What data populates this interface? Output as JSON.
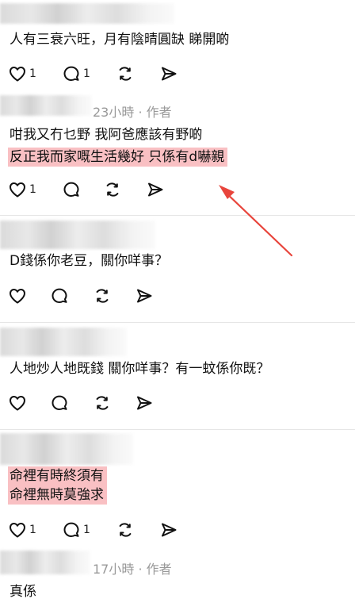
{
  "accent": "#e8453c",
  "highlight_color": "#f9c0c3",
  "comments": [
    {
      "lines": [
        "人有三衰六旺，月有陰晴圓缺 睇開啲"
      ],
      "likes": "1",
      "replies": "1"
    },
    {
      "time": "23小時",
      "separator": "·",
      "author_tag": "作者",
      "lines": [
        "咁我又冇乜野 我阿爸應該有野啲"
      ],
      "highlighted_lines": [
        "反正我而家嘅生活幾好 只係有d嚇親"
      ],
      "likes": "1",
      "replies": ""
    },
    {
      "lines": [
        "D錢係你老豆，關你咩事？"
      ],
      "likes": "",
      "replies": ""
    },
    {
      "lines": [
        "人地炒人地既錢 關你咩事？有一蚊係你既？"
      ],
      "likes": "",
      "replies": ""
    },
    {
      "highlighted_lines": [
        "命裡有時終須有",
        "命裡無時莫強求"
      ],
      "likes": "1",
      "replies": "1"
    },
    {
      "time": "17小時",
      "separator": "·",
      "author_tag": "作者",
      "lines": [
        "真係"
      ]
    }
  ],
  "icons": {
    "like": "heart-icon",
    "reply": "comment-bubble-icon",
    "repost": "repost-icon",
    "share": "send-icon"
  }
}
